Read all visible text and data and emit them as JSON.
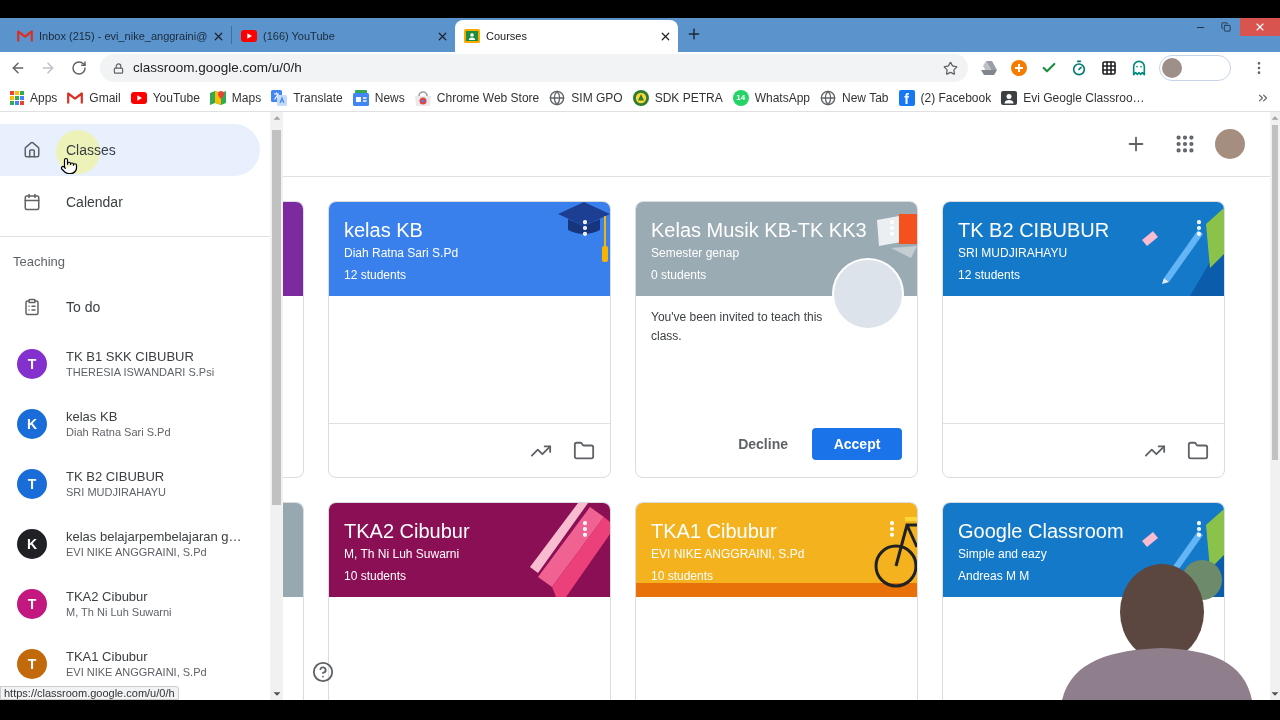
{
  "browser": {
    "tabs": [
      {
        "kind": "mail",
        "title": "Inbox (215) - evi_nike_anggraini@",
        "selected": false
      },
      {
        "kind": "video",
        "title": "(166) YouTube",
        "selected": false
      },
      {
        "kind": "classroom",
        "title": "Courses",
        "selected": true
      }
    ],
    "address": "classroom.google.com/u/0/h",
    "bookmarks": [
      {
        "kind": "apps",
        "label": "Apps"
      },
      {
        "kind": "mail",
        "label": "Gmail"
      },
      {
        "kind": "video",
        "label": "YouTube"
      },
      {
        "kind": "map",
        "label": "Maps"
      },
      {
        "kind": "translate",
        "label": "Translate"
      },
      {
        "kind": "news",
        "label": "News"
      },
      {
        "kind": "store",
        "label": "Chrome Web Store"
      },
      {
        "kind": "globe",
        "label": "SIM GPO"
      },
      {
        "kind": "emblem",
        "label": "SDK PETRA"
      },
      {
        "kind": "chat",
        "badge": "14",
        "label": "WhatsApp"
      },
      {
        "kind": "globe",
        "label": "New Tab"
      },
      {
        "kind": "letter",
        "glyph": "f",
        "label": "(2) Facebook"
      },
      {
        "kind": "contact",
        "label": "Evi Geogle Classroo…"
      }
    ]
  },
  "sidebar": {
    "nav": [
      {
        "kind": "home",
        "label": "Classes",
        "selected": true
      },
      {
        "kind": "calendar",
        "label": "Calendar",
        "selected": false
      }
    ],
    "section_heading": "Teaching",
    "items": [
      {
        "kind": "todo",
        "label": "To do",
        "selected": false
      },
      {
        "kind": "class",
        "initial": "T",
        "name": "TK B1 SKK CIBUBUR",
        "teacher": "THERESIA ISWANDARI S.Psi",
        "color": "#8430ce",
        "selected": false
      },
      {
        "kind": "class",
        "initial": "K",
        "name": "kelas KB",
        "teacher": "Diah Ratna Sari S.Pd",
        "color": "#1a6dd8",
        "selected": false
      },
      {
        "kind": "class",
        "initial": "T",
        "name": "TK B2 CIBUBUR",
        "teacher": "SRI MUDJIRAHAYU",
        "color": "#1a6dd8",
        "selected": false
      },
      {
        "kind": "class",
        "initial": "K",
        "name": "kelas belajarpembelajaran g…",
        "teacher": "EVI NIKE ANGGRAINI, S.Pd",
        "color": "#202124",
        "selected": false
      },
      {
        "kind": "class",
        "initial": "T",
        "name": "TKA2 Cibubur",
        "teacher": "M, Th Ni Luh Suwarni",
        "color": "#c2187f",
        "selected": false
      },
      {
        "kind": "class",
        "initial": "T",
        "name": "TKA1 Cibubur",
        "teacher": "EVI NIKE ANGGRAINI, S.Pd",
        "color": "#c26a0b",
        "selected": false
      }
    ]
  },
  "classes_grid": [
    {
      "kind": "partial",
      "color": "#7b2aa0"
    },
    {
      "kind": "class",
      "banner": {
        "kind": "cap"
      },
      "title": "kelas KB",
      "subtitle": "Diah Ratna Sari S.Pd",
      "detail": "12 students",
      "color": "#3a80ec"
    },
    {
      "kind": "invite",
      "banner": {
        "kind": "brush"
      },
      "title": "Kelas Musik KB-TK KK3",
      "subtitle": "Semester genap",
      "detail": "0 students",
      "color": "#9aabb3",
      "message": "You've been invited to teach this class.",
      "decline": "Decline",
      "accept": "Accept"
    },
    {
      "kind": "class",
      "banner": {
        "kind": "pencils"
      },
      "title": "TK B2 CIBUBUR",
      "subtitle": "SRI MUDJIRAHAYU",
      "detail": "12 students",
      "color": "#1479c9"
    },
    {
      "kind": "partial",
      "color": "#98a8b0"
    },
    {
      "kind": "class",
      "banner": {
        "kind": "tickets"
      },
      "title": "TKA2 Cibubur",
      "subtitle": "M, Th Ni Luh Suwarni",
      "detail": "10 students",
      "color": "#8a0f54"
    },
    {
      "kind": "class",
      "banner": {
        "kind": "bicycle"
      },
      "title": "TKA1 Cibubur",
      "subtitle": "EVI NIKE ANGGRAINI, S.Pd",
      "detail": "10 students",
      "color": "#f4b31e"
    },
    {
      "kind": "class",
      "banner": {
        "kind": "pencils"
      },
      "title": "Google Classroom",
      "subtitle": "Simple and eazy",
      "detail": "Andreas M M",
      "color": "#1479c9"
    }
  ],
  "status_url": "https://classroom.google.com/u/0/h"
}
